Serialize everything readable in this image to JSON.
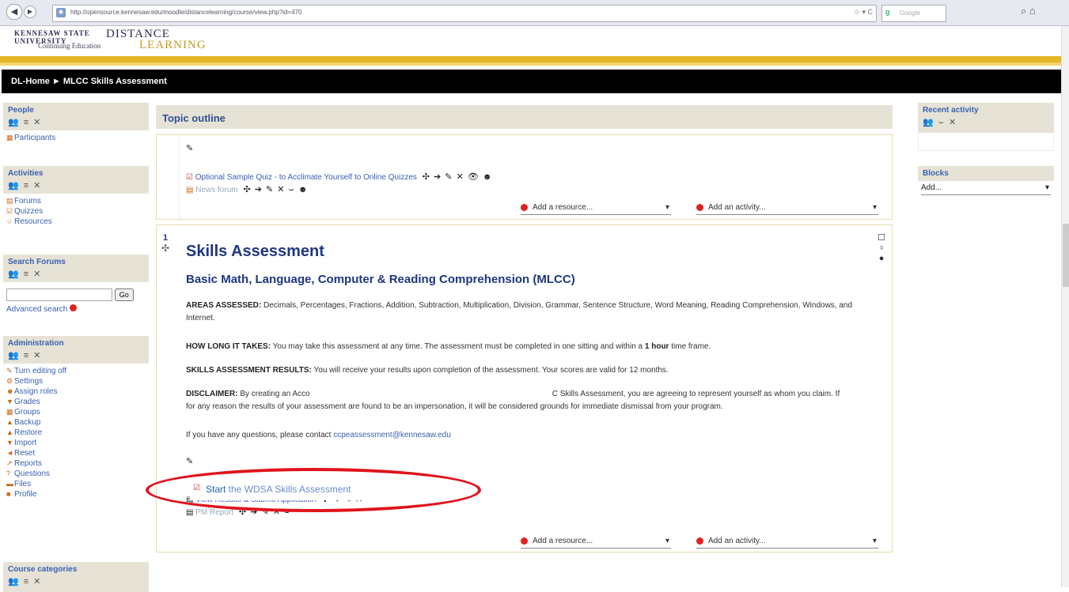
{
  "browser": {
    "url": "http://opensource.kennesaw.edu/moodle/distancelearning/course/view.php?id=470",
    "search_engine": "Google",
    "back_icon": "back-arrow-icon",
    "forward_icon": "forward-arrow-icon"
  },
  "logo": {
    "line1": "KENNESAW STATE UNIVERSITY",
    "line2": "Continuing Education",
    "brand1": "DISTANCE",
    "brand2": "LEARNING"
  },
  "breadcrumb": "DL-Home ► MLCC Skills Assessment",
  "left_blocks": {
    "people": {
      "title": "People",
      "items": [
        "Participants"
      ]
    },
    "activities": {
      "title": "Activities",
      "items": [
        "Forums",
        "Quizzes",
        "Resources"
      ]
    },
    "search": {
      "title": "Search Forums",
      "go": "Go",
      "advanced": "Advanced search"
    },
    "admin": {
      "title": "Administration",
      "items": [
        "Turn editing off",
        "Settings",
        "Assign roles",
        "Grades",
        "Groups",
        "Backup",
        "Restore",
        "Import",
        "Reset",
        "Reports",
        "Questions",
        "Files",
        "Profile"
      ]
    },
    "categories": {
      "title": "Course categories"
    }
  },
  "right_blocks": {
    "recent": {
      "title": "Recent activity"
    },
    "blocks": {
      "title": "Blocks",
      "select": "Add..."
    }
  },
  "main": {
    "topic_outline": "Topic outline",
    "section0": {
      "quiz_link": "Optional Sample Quiz - to Acclimate Yourself to Online Quizzes",
      "news_forum": "News forum",
      "add_resource": "Add a resource...",
      "add_activity": "Add an activity..."
    },
    "section1": {
      "number": "1",
      "title": "Skills Assessment",
      "subtitle": "Basic Math, Language, Computer & Reading Comprehension (MLCC)",
      "areas_label": "AREAS ASSESSED:",
      "areas_text": "Decimals, Percentages, Fractions, Addition, Subtraction, Multiplication, Division, Grammar, Sentence Structure, Word Meaning, Reading Comprehension, Windows, and Internet.",
      "howlong_label": "HOW LONG IT TAKES:",
      "howlong_text": "You may take this assessment at any time. The assessment must be completed in one sitting and within a",
      "howlong_bold": "1 hour",
      "howlong_tail": "time frame.",
      "results_label": "SKILLS ASSESSMENT RESULTS:",
      "results_text": "You will receive your results upon completion of the assessment. Your scores are valid for 12 months.",
      "disclaimer_label": "DISCLAIMER:",
      "disclaimer_a": "By creating an Acco",
      "disclaimer_b": "C Skills Assessment, you are agreeing to represent yourself as whom you claim. If",
      "disclaimer_c": "for any reason the results of your assessment are found to be an impersonation, it will be considered grounds for immediate dismissal from your program.",
      "questions_text": "If you have any questions, please contact",
      "email": "ccpeassessment@kennesaw.edu",
      "start_word": "Start",
      "start_rest": " the WDSA Skills Assessment",
      "view_results": "View Results & Submit Application",
      "pm_report": "PM Report",
      "add_resource": "Add a resource...",
      "add_activity": "Add an activity..."
    }
  },
  "colors": {
    "gold": "#e3b62a",
    "navy": "#1f3680",
    "highlight_oval": "#e0131b"
  }
}
